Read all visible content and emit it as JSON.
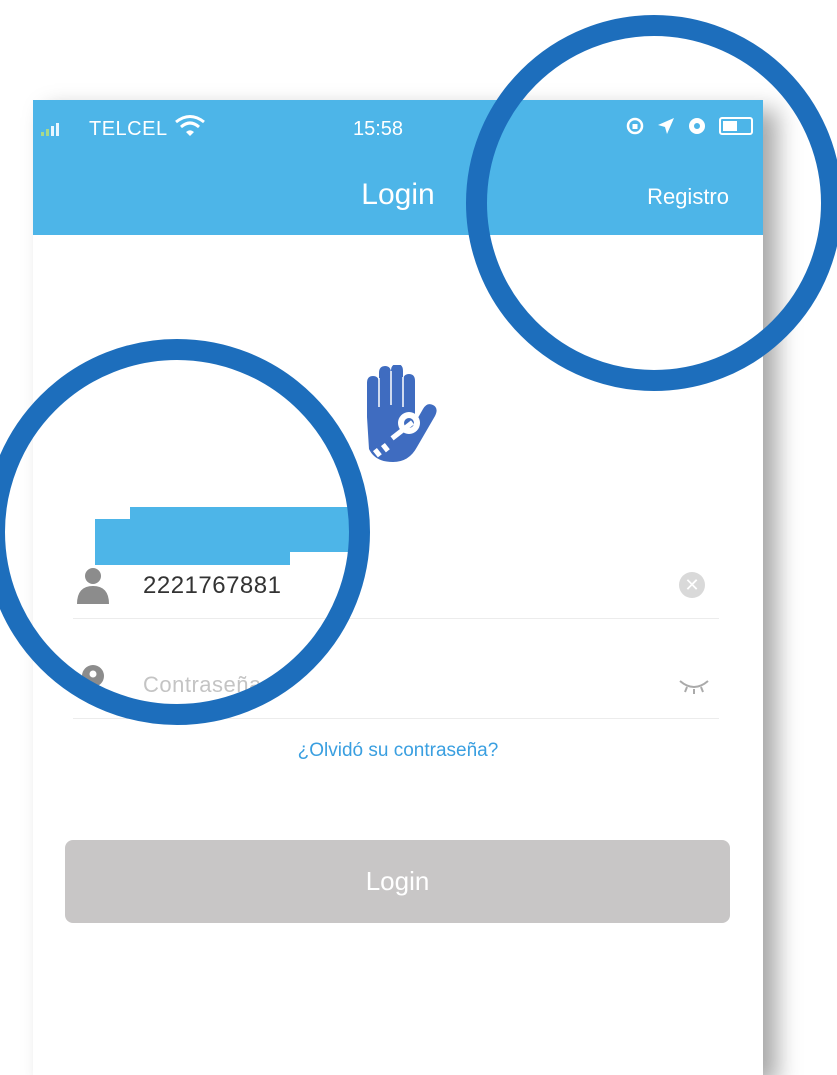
{
  "status_bar": {
    "carrier": "TELCEL",
    "time": "15:58"
  },
  "nav": {
    "title": "Login",
    "right_action": "Registro"
  },
  "form": {
    "username_value": "2221767881",
    "password_placeholder": "Contraseña"
  },
  "login_button_label": "Login",
  "forgot_link": "¿Olvidó su contraseña?",
  "colors": {
    "header": "#4db5e8",
    "annotation_ring": "#1d6ebc",
    "logo": "#3f6cc0",
    "button_disabled": "#c8c6c6"
  }
}
